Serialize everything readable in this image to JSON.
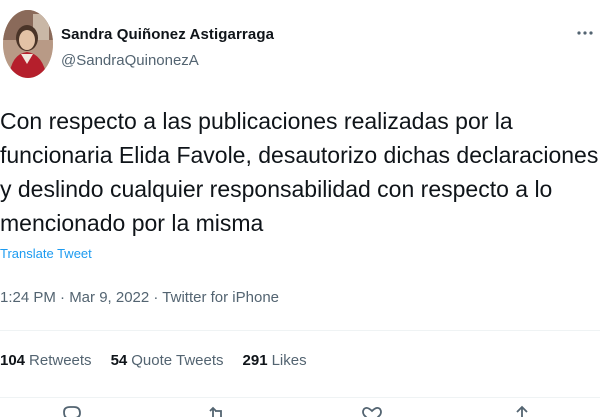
{
  "user": {
    "name": "Sandra Quiñonez Astigarraga",
    "handle": "@SandraQuinonezA"
  },
  "tweet": {
    "text": "Con respecto a las publicaciones realizadas por la funcionaria Elida Favole, desautorizo dichas declaraciones y deslindo cualquier responsabilidad con respecto a lo mencionado por la misma",
    "translate_label": "Translate Tweet",
    "meta": "1:24 PM · Mar 9, 2022 · Twitter for iPhone"
  },
  "stats": [
    {
      "count": "104",
      "label": "Retweets"
    },
    {
      "count": "54",
      "label": "Quote Tweets"
    },
    {
      "count": "291",
      "label": "Likes"
    }
  ],
  "icons": {
    "more": "more-icon",
    "reply": "reply-icon",
    "retweet": "retweet-icon",
    "like": "like-icon",
    "share": "share-icon"
  },
  "colors": {
    "text": "#0f1419",
    "secondary": "#536471",
    "link": "#1d9bf0",
    "divider": "#eff3f4"
  }
}
